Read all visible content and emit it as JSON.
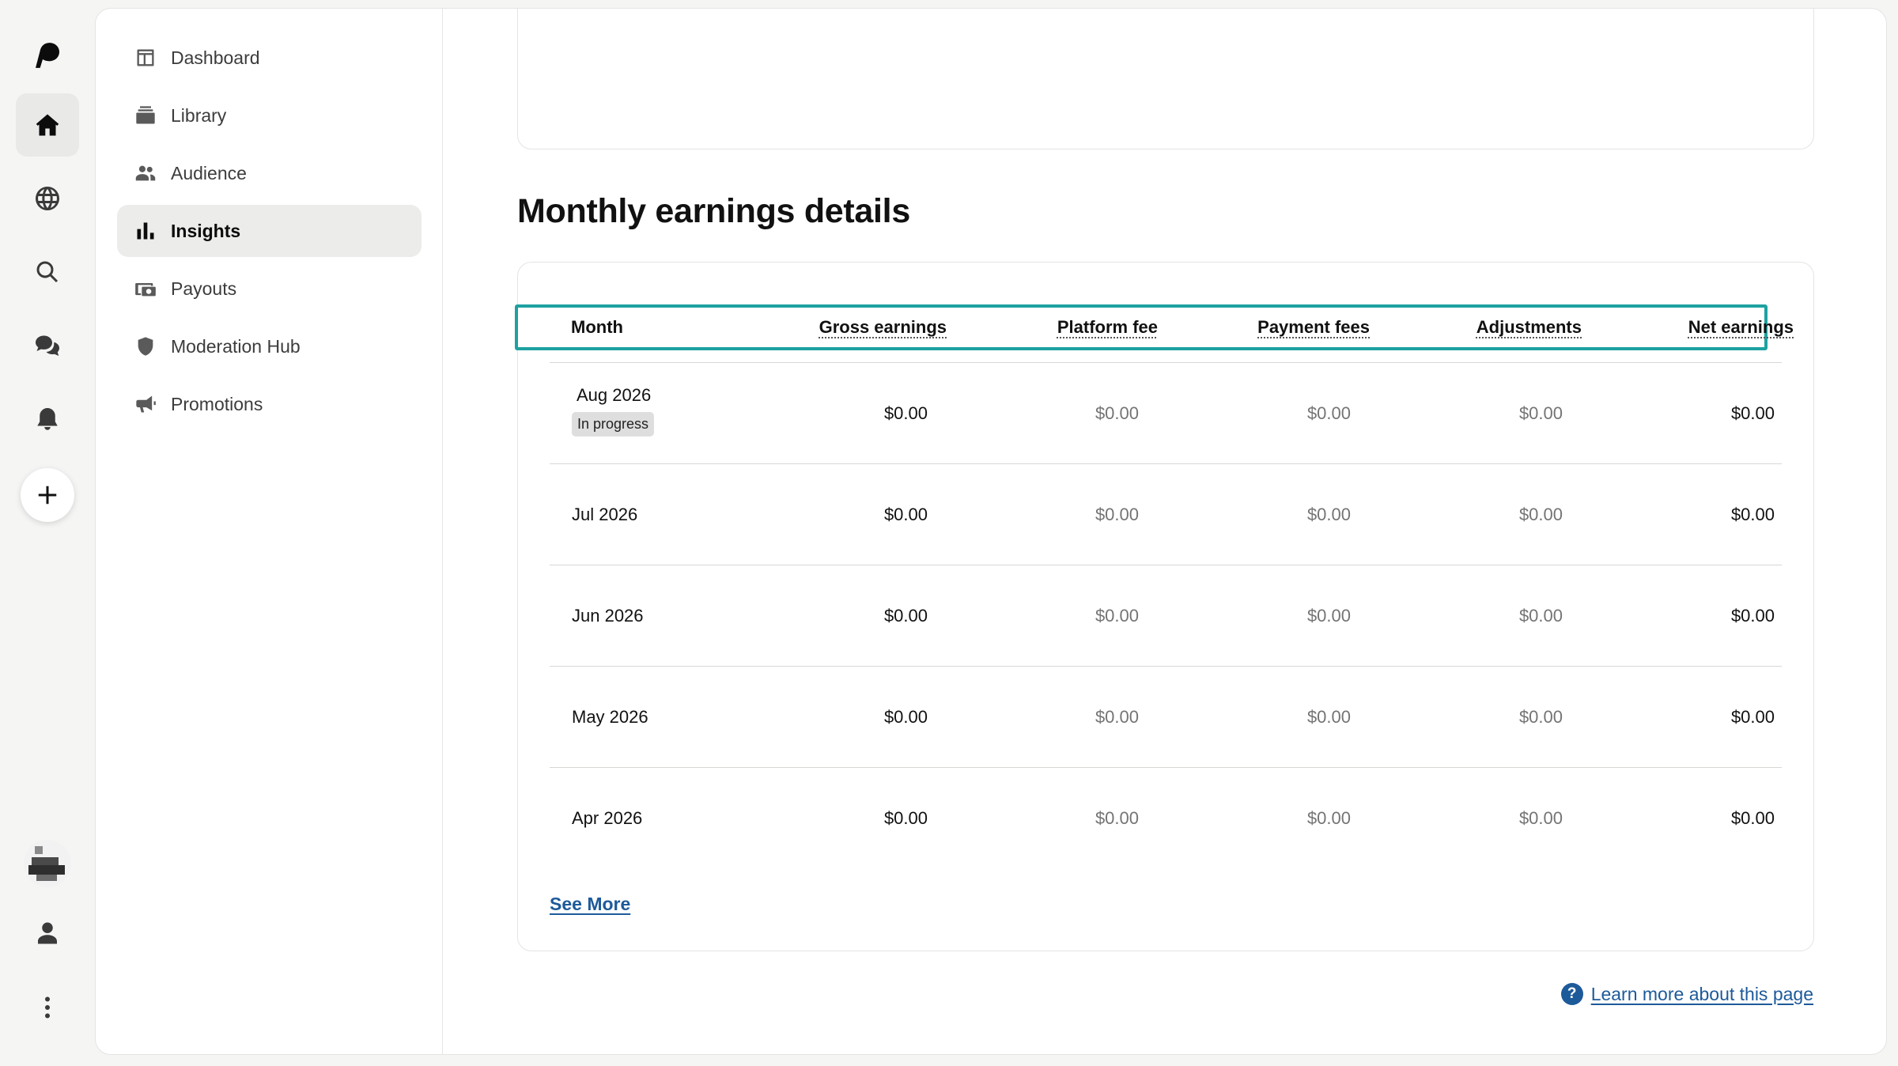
{
  "rail": {
    "items": [
      "logo-icon",
      "home-icon",
      "globe-icon",
      "search-icon",
      "chat-icon",
      "bell-icon",
      "plus-icon",
      "avatar",
      "user-icon",
      "more-vertical-icon"
    ]
  },
  "sidebar": {
    "items": [
      {
        "label": "Dashboard",
        "icon": "dashboard-icon"
      },
      {
        "label": "Library",
        "icon": "library-icon"
      },
      {
        "label": "Audience",
        "icon": "audience-icon"
      },
      {
        "label": "Insights",
        "icon": "insights-icon",
        "active": true
      },
      {
        "label": "Payouts",
        "icon": "payouts-icon"
      },
      {
        "label": "Moderation Hub",
        "icon": "shield-icon"
      },
      {
        "label": "Promotions",
        "icon": "megaphone-icon"
      }
    ]
  },
  "section": {
    "title": "Monthly earnings details"
  },
  "table": {
    "headers": [
      "Month",
      "Gross earnings",
      "Platform fee",
      "Payment fees",
      "Adjustments",
      "Net earnings"
    ],
    "rows": [
      {
        "month": "Aug 2026",
        "badge": "In progress",
        "gross": "$0.00",
        "platform": "$0.00",
        "payment": "$0.00",
        "adjustments": "$0.00",
        "net": "$0.00"
      },
      {
        "month": "Jul 2026",
        "gross": "$0.00",
        "platform": "$0.00",
        "payment": "$0.00",
        "adjustments": "$0.00",
        "net": "$0.00"
      },
      {
        "month": "Jun 2026",
        "gross": "$0.00",
        "platform": "$0.00",
        "payment": "$0.00",
        "adjustments": "$0.00",
        "net": "$0.00"
      },
      {
        "month": "May 2026",
        "gross": "$0.00",
        "platform": "$0.00",
        "payment": "$0.00",
        "adjustments": "$0.00",
        "net": "$0.00"
      },
      {
        "month": "Apr 2026",
        "gross": "$0.00",
        "platform": "$0.00",
        "payment": "$0.00",
        "adjustments": "$0.00",
        "net": "$0.00"
      }
    ],
    "see_more": "See More"
  },
  "footer": {
    "learn_more": "Learn more about this page",
    "help_glyph": "?"
  },
  "colors": {
    "highlight": "#1ea1a1",
    "link": "#1d5a9a",
    "active_nav_bg": "#ececeb"
  }
}
